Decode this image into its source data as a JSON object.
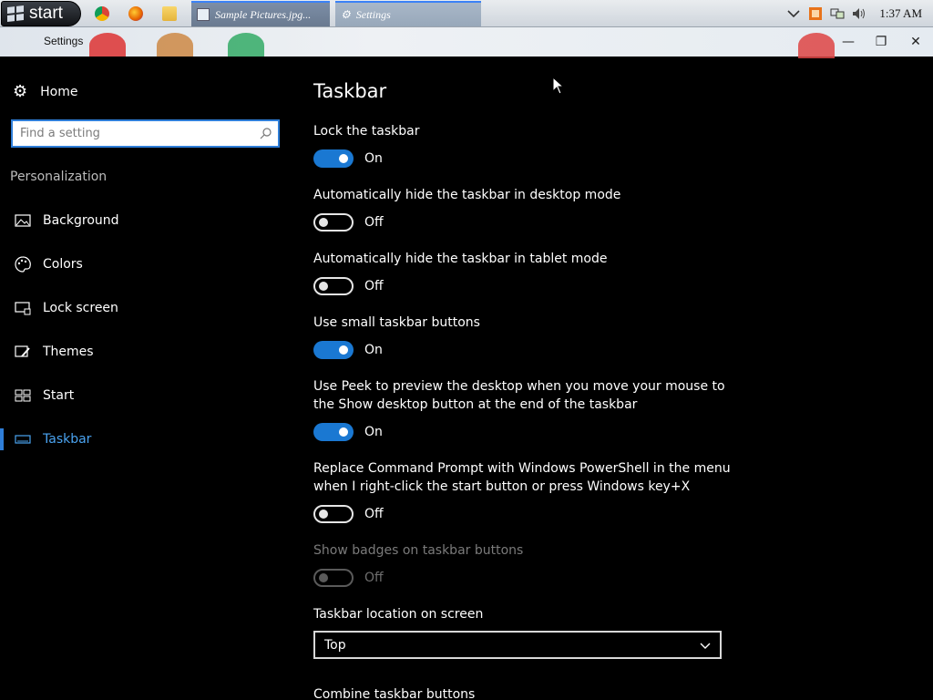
{
  "os_taskbar": {
    "start_label": "start",
    "quick_launch": [
      "chrome-icon",
      "firefox-icon",
      "folder-icon"
    ],
    "tasks": [
      {
        "label": "Sample Pictures.jpg...",
        "icon": "photo-viewer-icon"
      },
      {
        "label": "Settings",
        "icon": "gear-icon"
      }
    ],
    "tray": [
      "chevron-up-icon",
      "orange-app-icon",
      "network-icon",
      "volume-icon"
    ],
    "clock": "1:37 AM"
  },
  "window": {
    "title": "Settings",
    "controls": {
      "minimize": "minimize-icon",
      "restore": "restore-icon",
      "close": "close-icon"
    }
  },
  "sidebar": {
    "home_label": "Home",
    "search_placeholder": "Find a setting",
    "section_heading": "Personalization",
    "items": [
      {
        "label": "Background",
        "icon": "image-icon"
      },
      {
        "label": "Colors",
        "icon": "palette-icon"
      },
      {
        "label": "Lock screen",
        "icon": "monitor-lock-icon"
      },
      {
        "label": "Themes",
        "icon": "brush-icon"
      },
      {
        "label": "Start",
        "icon": "start-tiles-icon"
      },
      {
        "label": "Taskbar",
        "icon": "taskbar-icon",
        "active": true
      }
    ]
  },
  "main": {
    "title": "Taskbar",
    "settings": [
      {
        "label": "Lock the taskbar",
        "state": "On"
      },
      {
        "label": "Automatically hide the taskbar in desktop mode",
        "state": "Off"
      },
      {
        "label": "Automatically hide the taskbar in tablet mode",
        "state": "Off"
      },
      {
        "label": "Use small taskbar buttons",
        "state": "On"
      },
      {
        "label": "Use Peek to preview the desktop when you move your mouse to the Show desktop button at the end of the taskbar",
        "state": "On"
      },
      {
        "label": "Replace Command Prompt with Windows PowerShell in the menu when I right-click the start button or press Windows key+X",
        "state": "Off"
      },
      {
        "label": "Show badges on taskbar buttons",
        "state": "Off",
        "disabled": true
      }
    ],
    "location_label": "Taskbar location on screen",
    "location_value": "Top",
    "combine_label": "Combine taskbar buttons"
  },
  "colors": {
    "accent": "#1a78d2",
    "background": "#000000",
    "text": "#ffffff"
  }
}
